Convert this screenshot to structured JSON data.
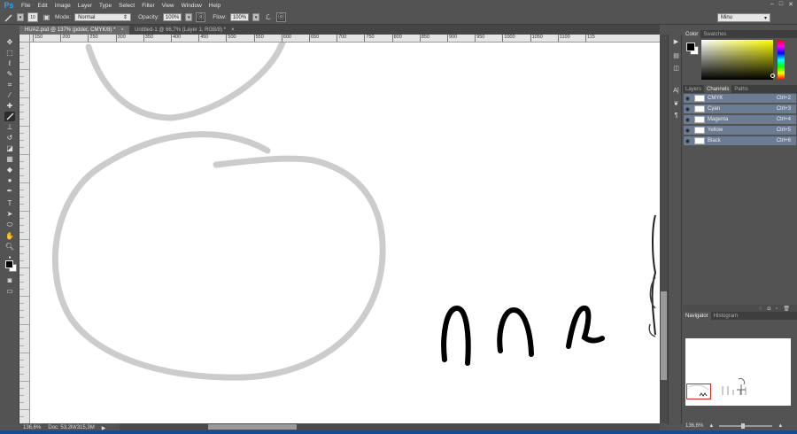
{
  "app": {
    "logo": "Ps"
  },
  "menu": [
    "File",
    "Edit",
    "Image",
    "Layer",
    "Type",
    "Select",
    "Filter",
    "View",
    "Window",
    "Help"
  ],
  "window_controls": [
    "–",
    "□",
    "✕"
  ],
  "options": {
    "brush_size": "10",
    "mode_label": "Mode:",
    "mode_value": "Normal",
    "opacity_label": "Opacity:",
    "opacity_value": "100%",
    "flow_label": "Flow:",
    "flow_value": "100%",
    "workspace": "Minu"
  },
  "tabs": [
    {
      "label": "HUA2.psd @ 137% (pdder, CMYK/8) *",
      "close": "×"
    },
    {
      "label": "Untitled-1 @ 66,7% (Layer 1, RGB/8) *",
      "close": "×"
    }
  ],
  "ruler_labels": [
    "150",
    "200",
    "250",
    "300",
    "350",
    "400",
    "450",
    "500",
    "550",
    "600",
    "650",
    "700",
    "750",
    "800",
    "850",
    "900",
    "950",
    "1000",
    "1050",
    "1100",
    "115"
  ],
  "status": {
    "zoom": "136,6%",
    "doc": "Doc: 53,2M/315,3M",
    "arrow": "▶"
  },
  "color_panel": {
    "tabs": [
      "Color",
      "Swatches"
    ]
  },
  "channels_panel": {
    "tabs": [
      "Layers",
      "Channels",
      "Paths"
    ],
    "channels": [
      {
        "name": "CMYK",
        "shortcut": "Ctrl+2"
      },
      {
        "name": "Cyan",
        "shortcut": "Ctrl+3"
      },
      {
        "name": "Magenta",
        "shortcut": "Ctrl+4"
      },
      {
        "name": "Yellow",
        "shortcut": "Ctrl+5"
      },
      {
        "name": "Black",
        "shortcut": "Ctrl+6"
      }
    ]
  },
  "navigator_panel": {
    "tabs": [
      "Navigator",
      "Histogram"
    ],
    "zoom": "136,6%"
  },
  "colors": {
    "accent_blue": "#2fa3f7",
    "channel_row": "#6c7c92",
    "nav_box": "#e02020"
  }
}
